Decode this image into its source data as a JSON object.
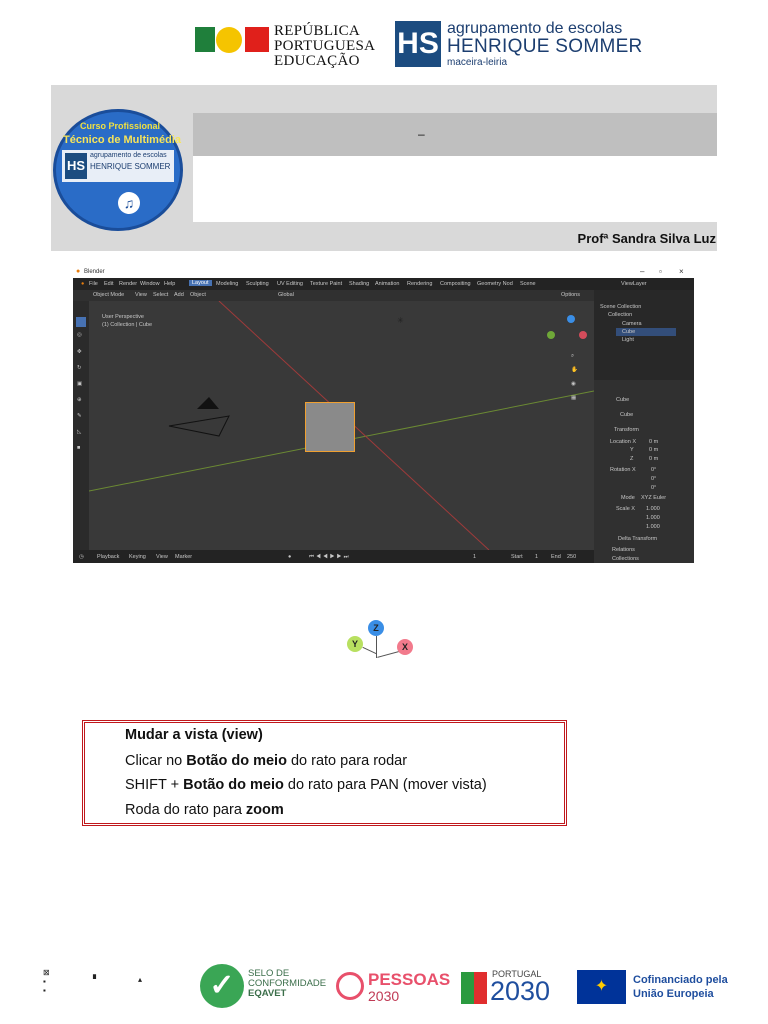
{
  "header": {
    "republica": [
      "REPÚBLICA",
      "PORTUGUESA",
      "EDUCAÇÃO"
    ],
    "agrupamento": {
      "line1": "agrupamento de escolas",
      "line2": "HENRIQUE SOMMER",
      "line3": "maceira-leiria"
    },
    "logo_mark": "HS"
  },
  "banner": {
    "badge": {
      "line1": "Curso Profissional",
      "line2": "Técnico de Multimédia",
      "line3": "agrupamento de escolas",
      "line4": "HENRIQUE SOMMER",
      "mark": "HS"
    },
    "title": "–",
    "teacher": "Profª Sandra Silva Luz"
  },
  "blender": {
    "window_title": "Blender",
    "menu": [
      "File",
      "Edit",
      "Render",
      "Window",
      "Help"
    ],
    "workspaces": [
      "Layout",
      "Modeling",
      "Sculpting",
      "UV Editing",
      "Texture Paint",
      "Shading",
      "Animation",
      "Rendering",
      "Compositing",
      "Geometry Nod"
    ],
    "scene": "Scene",
    "view_layer": "ViewLayer",
    "toolbar": [
      "Object Mode",
      "View",
      "Select",
      "Add",
      "Object"
    ],
    "transform_orientation": "Global",
    "options_label": "Options",
    "viewport_info": [
      "User Perspective",
      "(1) Collection | Cube"
    ],
    "timeline": [
      "Playback",
      "Keying",
      "View",
      "Marker"
    ],
    "frame": {
      "current": "1",
      "start_label": "Start",
      "start": "1",
      "end_label": "End",
      "end": "250"
    },
    "outliner": {
      "root": "Scene Collection",
      "collection": "Collection",
      "items": [
        "Camera",
        "Cube",
        "Light"
      ]
    },
    "props": {
      "object_name": "Cube",
      "data_name": "Cube",
      "section": "Transform",
      "location": {
        "label": "Location X",
        "x": "0 m",
        "y": "0 m",
        "z": "0 m"
      },
      "rotation": {
        "label": "Rotation X",
        "x": "0°",
        "y": "0°",
        "z": "0°"
      },
      "mode_label": "Mode",
      "mode": "XYZ Euler",
      "scale": {
        "label": "Scale X",
        "x": "1.000",
        "y": "1.000",
        "z": "1.000"
      },
      "axis_y": "Y",
      "axis_z": "Z",
      "delta": "Delta Transform",
      "relations": "Relations",
      "collections": "Collections"
    }
  },
  "gizmo": {
    "x": "X",
    "y": "Y",
    "z": "Z",
    "x_color": "#f27a8c",
    "y_color": "#b8e060",
    "z_color": "#3a8ee6"
  },
  "instructions": {
    "heading": "Mudar a vista (view)",
    "line1_pre": "Clicar no ",
    "line1_bold": "Botão do meio",
    "line1_post": " do rato para rodar",
    "line2_pre": "SHIFT + ",
    "line2_bold": "Botão do meio",
    "line2_post": " do rato para PAN (mover  vista)",
    "line3_pre": "Roda do rato para ",
    "line3_bold": "zoom"
  },
  "footer": {
    "eqavet": [
      "SELO DE",
      "CONFORMIDADE",
      "EQAVET"
    ],
    "pessoas": "PESSOAS",
    "pessoas_year": "2030",
    "portugal": "PORTUGAL",
    "portugal_year": "2030",
    "eu": [
      "Cofinanciado pela",
      "União Europeia"
    ]
  }
}
